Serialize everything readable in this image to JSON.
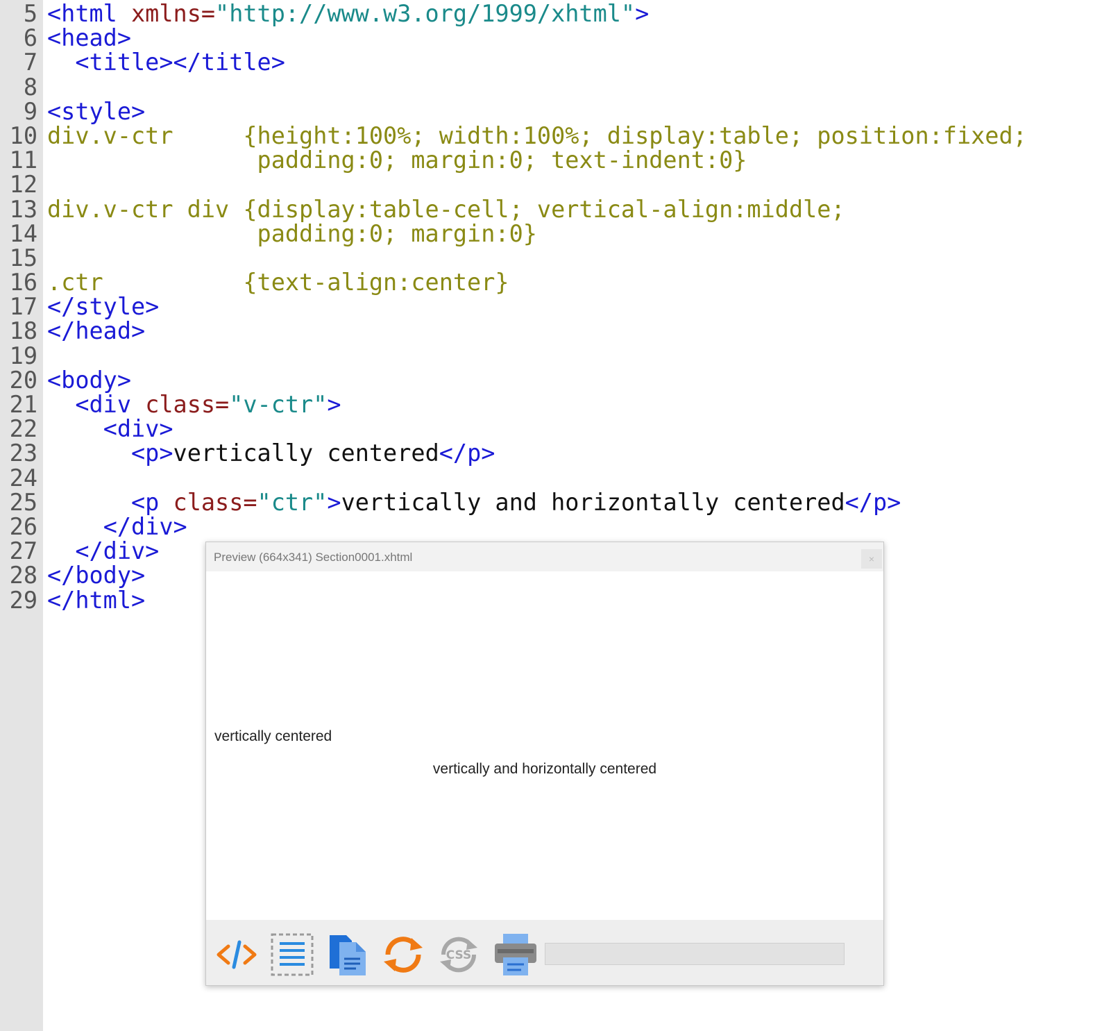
{
  "editor": {
    "lines": [
      {
        "num": "5",
        "html": "<span class=\"tag\">&lt;html</span> <span class=\"attr\">xmlns=</span><span class=\"str\">\"http://www.w3.org/1999/xhtml\"</span><span class=\"tag\">&gt;</span>"
      },
      {
        "num": "6",
        "html": "<span class=\"tag\">&lt;head&gt;</span>"
      },
      {
        "num": "7",
        "html": "  <span class=\"tag\">&lt;title&gt;&lt;/title&gt;</span>"
      },
      {
        "num": "8",
        "html": ""
      },
      {
        "num": "9",
        "html": "<span class=\"tag\">&lt;style&gt;</span>"
      },
      {
        "num": "10",
        "html": "<span class=\"css\">div.v-ctr     {height:100%; width:100%; display:table; position:fixed;</span>"
      },
      {
        "num": "11",
        "html": "<span class=\"css\">               padding:0; margin:0; text-indent:0}</span>"
      },
      {
        "num": "12",
        "html": ""
      },
      {
        "num": "13",
        "html": "<span class=\"css\">div.v-ctr div {display:table-cell; vertical-align:middle;</span>"
      },
      {
        "num": "14",
        "html": "<span class=\"css\">               padding:0; margin:0}</span>"
      },
      {
        "num": "15",
        "html": ""
      },
      {
        "num": "16",
        "html": "<span class=\"css\">.ctr          {text-align:center}</span>"
      },
      {
        "num": "17",
        "html": "<span class=\"tag\">&lt;/style&gt;</span>"
      },
      {
        "num": "18",
        "html": "<span class=\"tag\">&lt;/head&gt;</span>"
      },
      {
        "num": "19",
        "html": ""
      },
      {
        "num": "20",
        "html": "<span class=\"tag\">&lt;body&gt;</span>"
      },
      {
        "num": "21",
        "html": "  <span class=\"tag\">&lt;div</span> <span class=\"attr\">class=</span><span class=\"str\">\"v-ctr\"</span><span class=\"tag\">&gt;</span>"
      },
      {
        "num": "22",
        "html": "    <span class=\"tag\">&lt;div&gt;</span>"
      },
      {
        "num": "23",
        "html": "      <span class=\"tag\">&lt;p&gt;</span><span class=\"plain\">vertically centered</span><span class=\"tag\">&lt;/p&gt;</span>"
      },
      {
        "num": "24",
        "html": ""
      },
      {
        "num": "25",
        "html": "      <span class=\"tag\">&lt;p</span> <span class=\"attr\">class=</span><span class=\"str\">\"ctr\"</span><span class=\"tag\">&gt;</span><span class=\"plain\">vertically and horizontally centered</span><span class=\"tag\">&lt;/p&gt;</span>"
      },
      {
        "num": "26",
        "html": "    <span class=\"tag\">&lt;/div&gt;</span>"
      },
      {
        "num": "27",
        "html": "  <span class=\"tag\">&lt;/div&gt;</span>"
      },
      {
        "num": "28",
        "html": "<span class=\"tag\">&lt;/body&gt;</span>"
      },
      {
        "num": "29",
        "html": "<span class=\"tag\">&lt;/html&gt;</span>"
      }
    ]
  },
  "preview": {
    "title": "Preview (664x341) Section0001.xhtml",
    "close_label": "×",
    "text_vertical": "vertically centered",
    "text_both": "vertically and horizontally centered",
    "toolbar_icons": [
      "code-view-icon",
      "text-view-icon",
      "documents-icon",
      "refresh-icon",
      "css-toggle-icon",
      "print-icon"
    ]
  },
  "colors": {
    "tag": "#1a1ad6",
    "attribute": "#8b1c1c",
    "string": "#1a8a8a",
    "css": "#8a8a14",
    "gutter": "#e4e4e4"
  }
}
